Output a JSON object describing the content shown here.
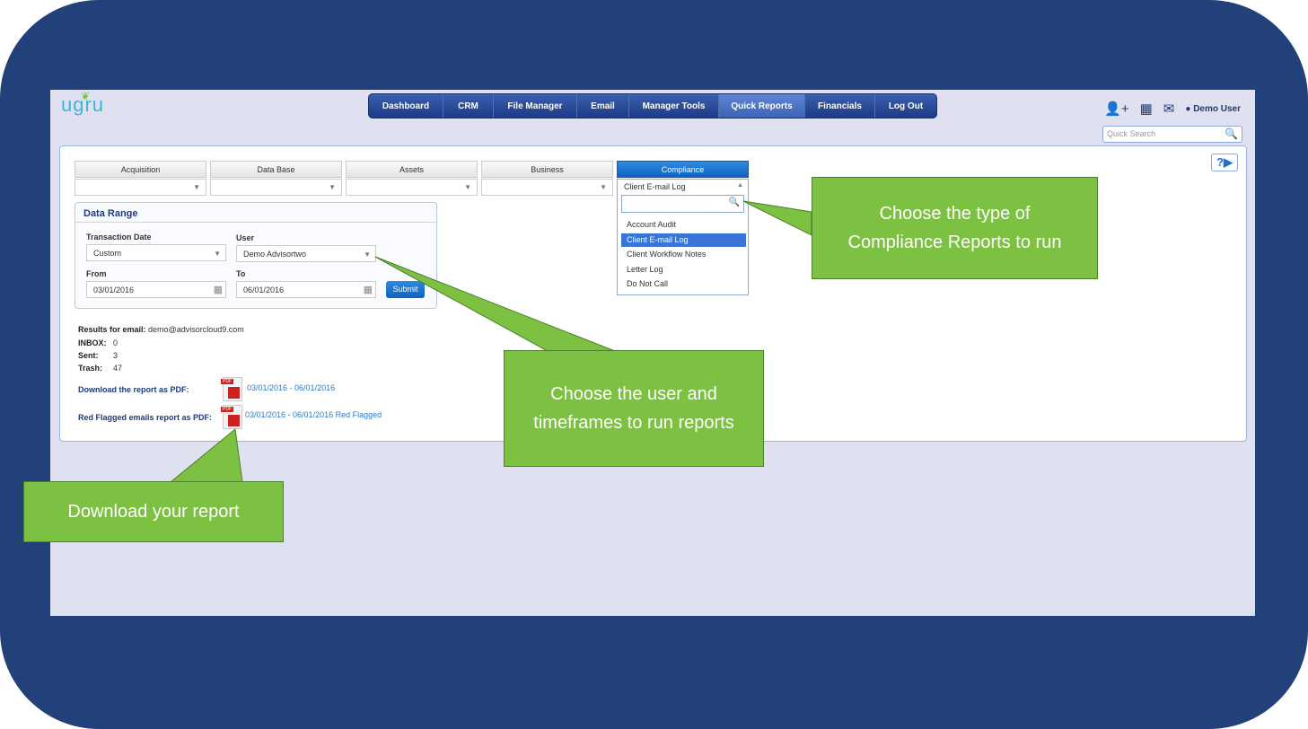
{
  "logo": "ugru",
  "nav": [
    "Dashboard",
    "CRM",
    "File Manager",
    "Email",
    "Manager Tools",
    "Quick Reports",
    "Financials",
    "Log Out"
  ],
  "nav_active": "Quick Reports",
  "header": {
    "user": "Demo User",
    "search_placeholder": "Quick Search",
    "help": "?▶"
  },
  "tabs": [
    "Acquisition",
    "Data Base",
    "Assets",
    "Business",
    "Compliance"
  ],
  "compliance": {
    "selected": "Client E-mail Log",
    "options": [
      "Account Audit",
      "Client E-mail Log",
      "Client Workflow Notes",
      "Letter Log",
      "Do Not Call"
    ]
  },
  "data_range": {
    "title": "Data Range",
    "transaction_label": "Transaction Date",
    "transaction_value": "Custom",
    "user_label": "User",
    "user_value": "Demo Advisortwo",
    "from_label": "From",
    "from_value": "03/01/2016",
    "to_label": "To",
    "to_value": "06/01/2016",
    "submit": "Submit"
  },
  "results": {
    "email_label": "Results for email:",
    "email": "demo@advisorcloud9.com",
    "inbox_label": "INBOX:",
    "inbox": "0",
    "sent_label": "Sent:",
    "sent": "3",
    "trash_label": "Trash:",
    "trash": "47",
    "download_label": "Download the report as PDF:",
    "download_link": "03/01/2016 - 06/01/2016",
    "flagged_label": "Red Flagged emails report as PDF:",
    "flagged_link": "03/01/2016 - 06/01/2016 Red Flagged"
  },
  "callouts": {
    "compliance": "Choose the type of Compliance Reports to run",
    "user": "Choose the user and timeframes to run reports",
    "download": "Download your report"
  },
  "colors": {
    "frame": "#22407a",
    "callout": "#7dc142",
    "accent": "#0f62c2"
  }
}
